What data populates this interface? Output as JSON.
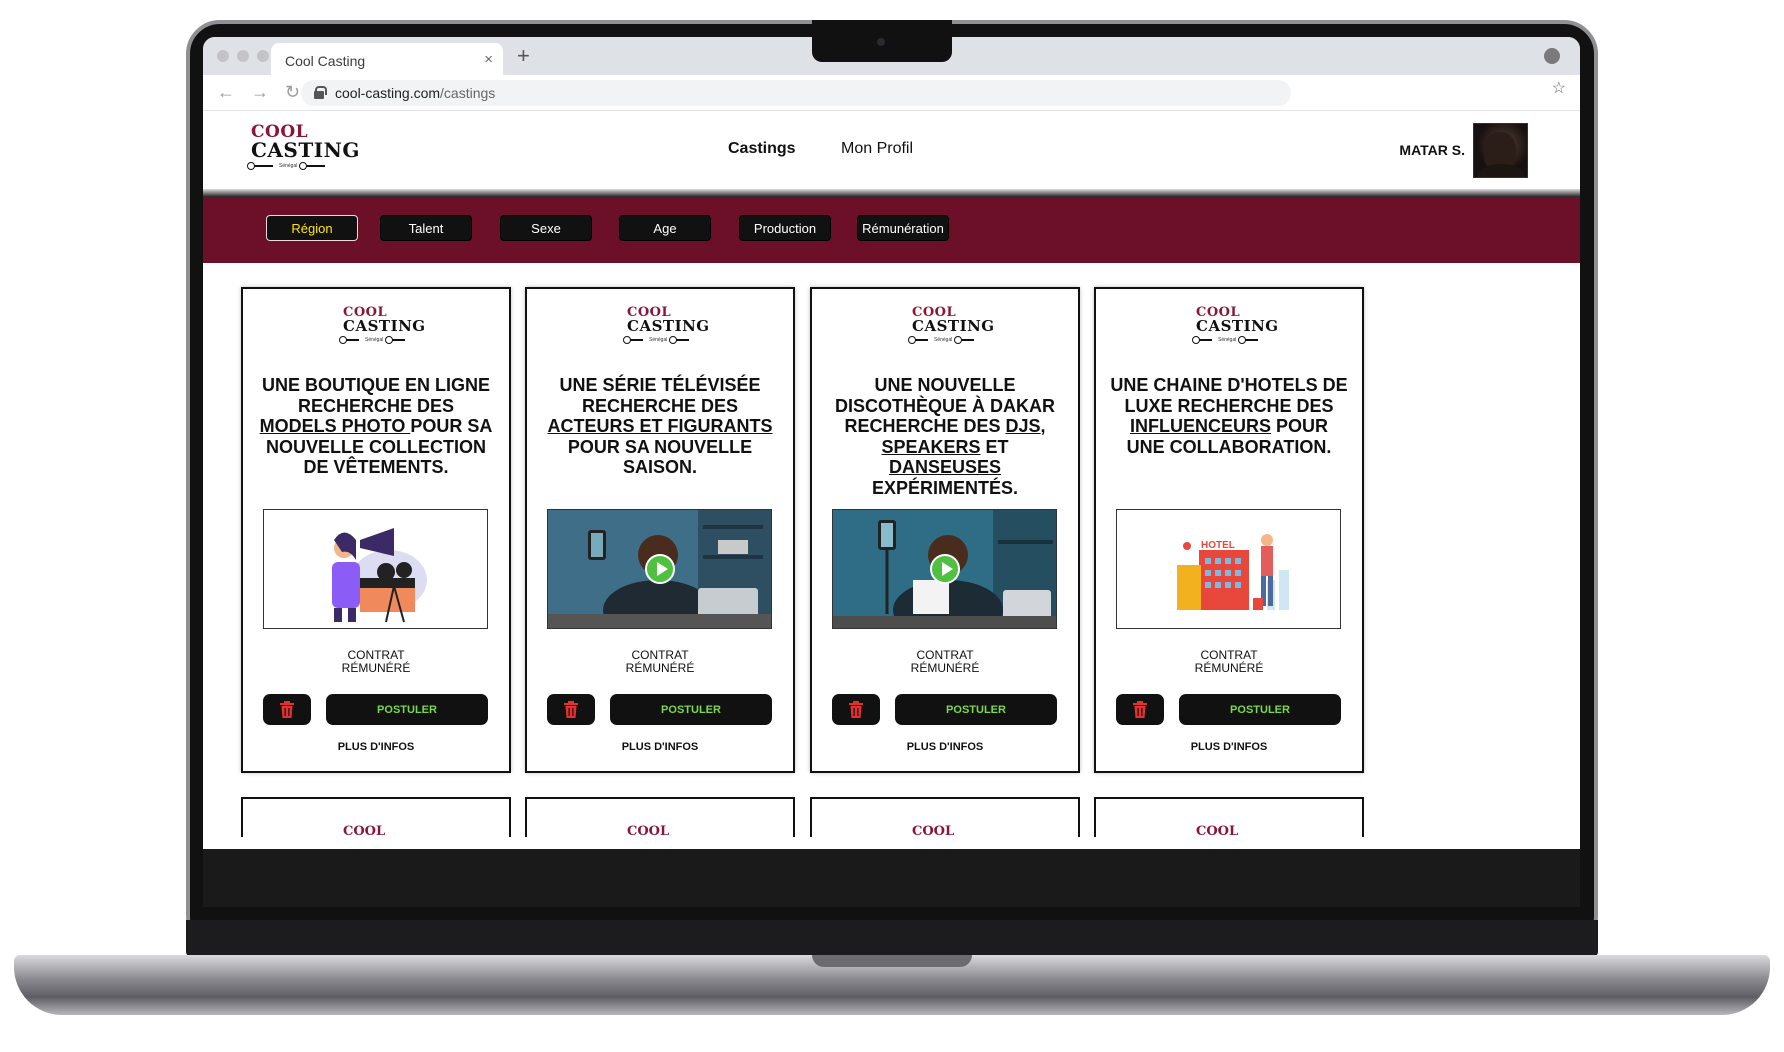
{
  "browser": {
    "tab_title": "Cool Casting",
    "tab_close": "×",
    "new_tab": "+",
    "url_domain": "cool-casting.com",
    "url_path": "/castings"
  },
  "brand": {
    "cool": "COOL",
    "casting": "CASTING",
    "tagline": "Sénégal"
  },
  "nav": {
    "castings": "Castings",
    "profil": "Mon Profil"
  },
  "user": {
    "name": "MATAR S."
  },
  "filters": [
    "Région",
    "Talent",
    "Sexe",
    "Age",
    "Production",
    "Rémunération"
  ],
  "active_filter": "Région",
  "cards": [
    {
      "title_parts": [
        "UNE BOUTIQUE EN LIGNE RECHERCHE DES ",
        "MODELS PHOTO ",
        "POUR SA NOUVELLE COLLECTION DE VÊTEMENTS."
      ],
      "media": "illustration-film-director-icon",
      "contract_line1": "CONTRAT",
      "contract_line2": "RÉMUNÉRÉ",
      "apply": "POSTULER",
      "more": "PLUS D'INFOS"
    },
    {
      "title_parts": [
        "UNE SÉRIE TÉLÉVISÉE RECHERCHE DES ",
        "ACTEURS ET FIGURANTS",
        " POUR SA NOUVELLE SAISON."
      ],
      "media": "video-thumbnail",
      "contract_line1": "CONTRAT",
      "contract_line2": "RÉMUNÉRÉ",
      "apply": "POSTULER",
      "more": "PLUS D'INFOS"
    },
    {
      "title_parts": [
        "UNE NOUVELLE DISCOTHÈQUE À DAKAR RECHERCHE DES ",
        "DJs, SPEAKERS",
        " ET ",
        "DANSEUSES",
        " EXPÉRIMENTÉS."
      ],
      "media": "video-thumbnail",
      "contract_line1": "CONTRAT",
      "contract_line2": "RÉMUNÉRÉ",
      "apply": "POSTULER",
      "more": "PLUS D'INFOS"
    },
    {
      "title_parts": [
        "UNE CHAINE D'HOTELS DE LUXE RECHERCHE DES ",
        "INFLUENCEURS",
        " POUR UNE COLLABORATION."
      ],
      "media": "illustration-hotel-icon",
      "hotel_sign": "HOTEL",
      "contract_line1": "CONTRAT",
      "contract_line2": "RÉMUNÉRÉ",
      "apply": "POSTULER",
      "more": "PLUS D'INFOS"
    }
  ],
  "colors": {
    "brand_burgundy": "#6b1028",
    "logo_red": "#8a1538",
    "apply_green": "#7bd84a",
    "trash_red": "#e53030",
    "active_filter_text": "#ffe600"
  }
}
